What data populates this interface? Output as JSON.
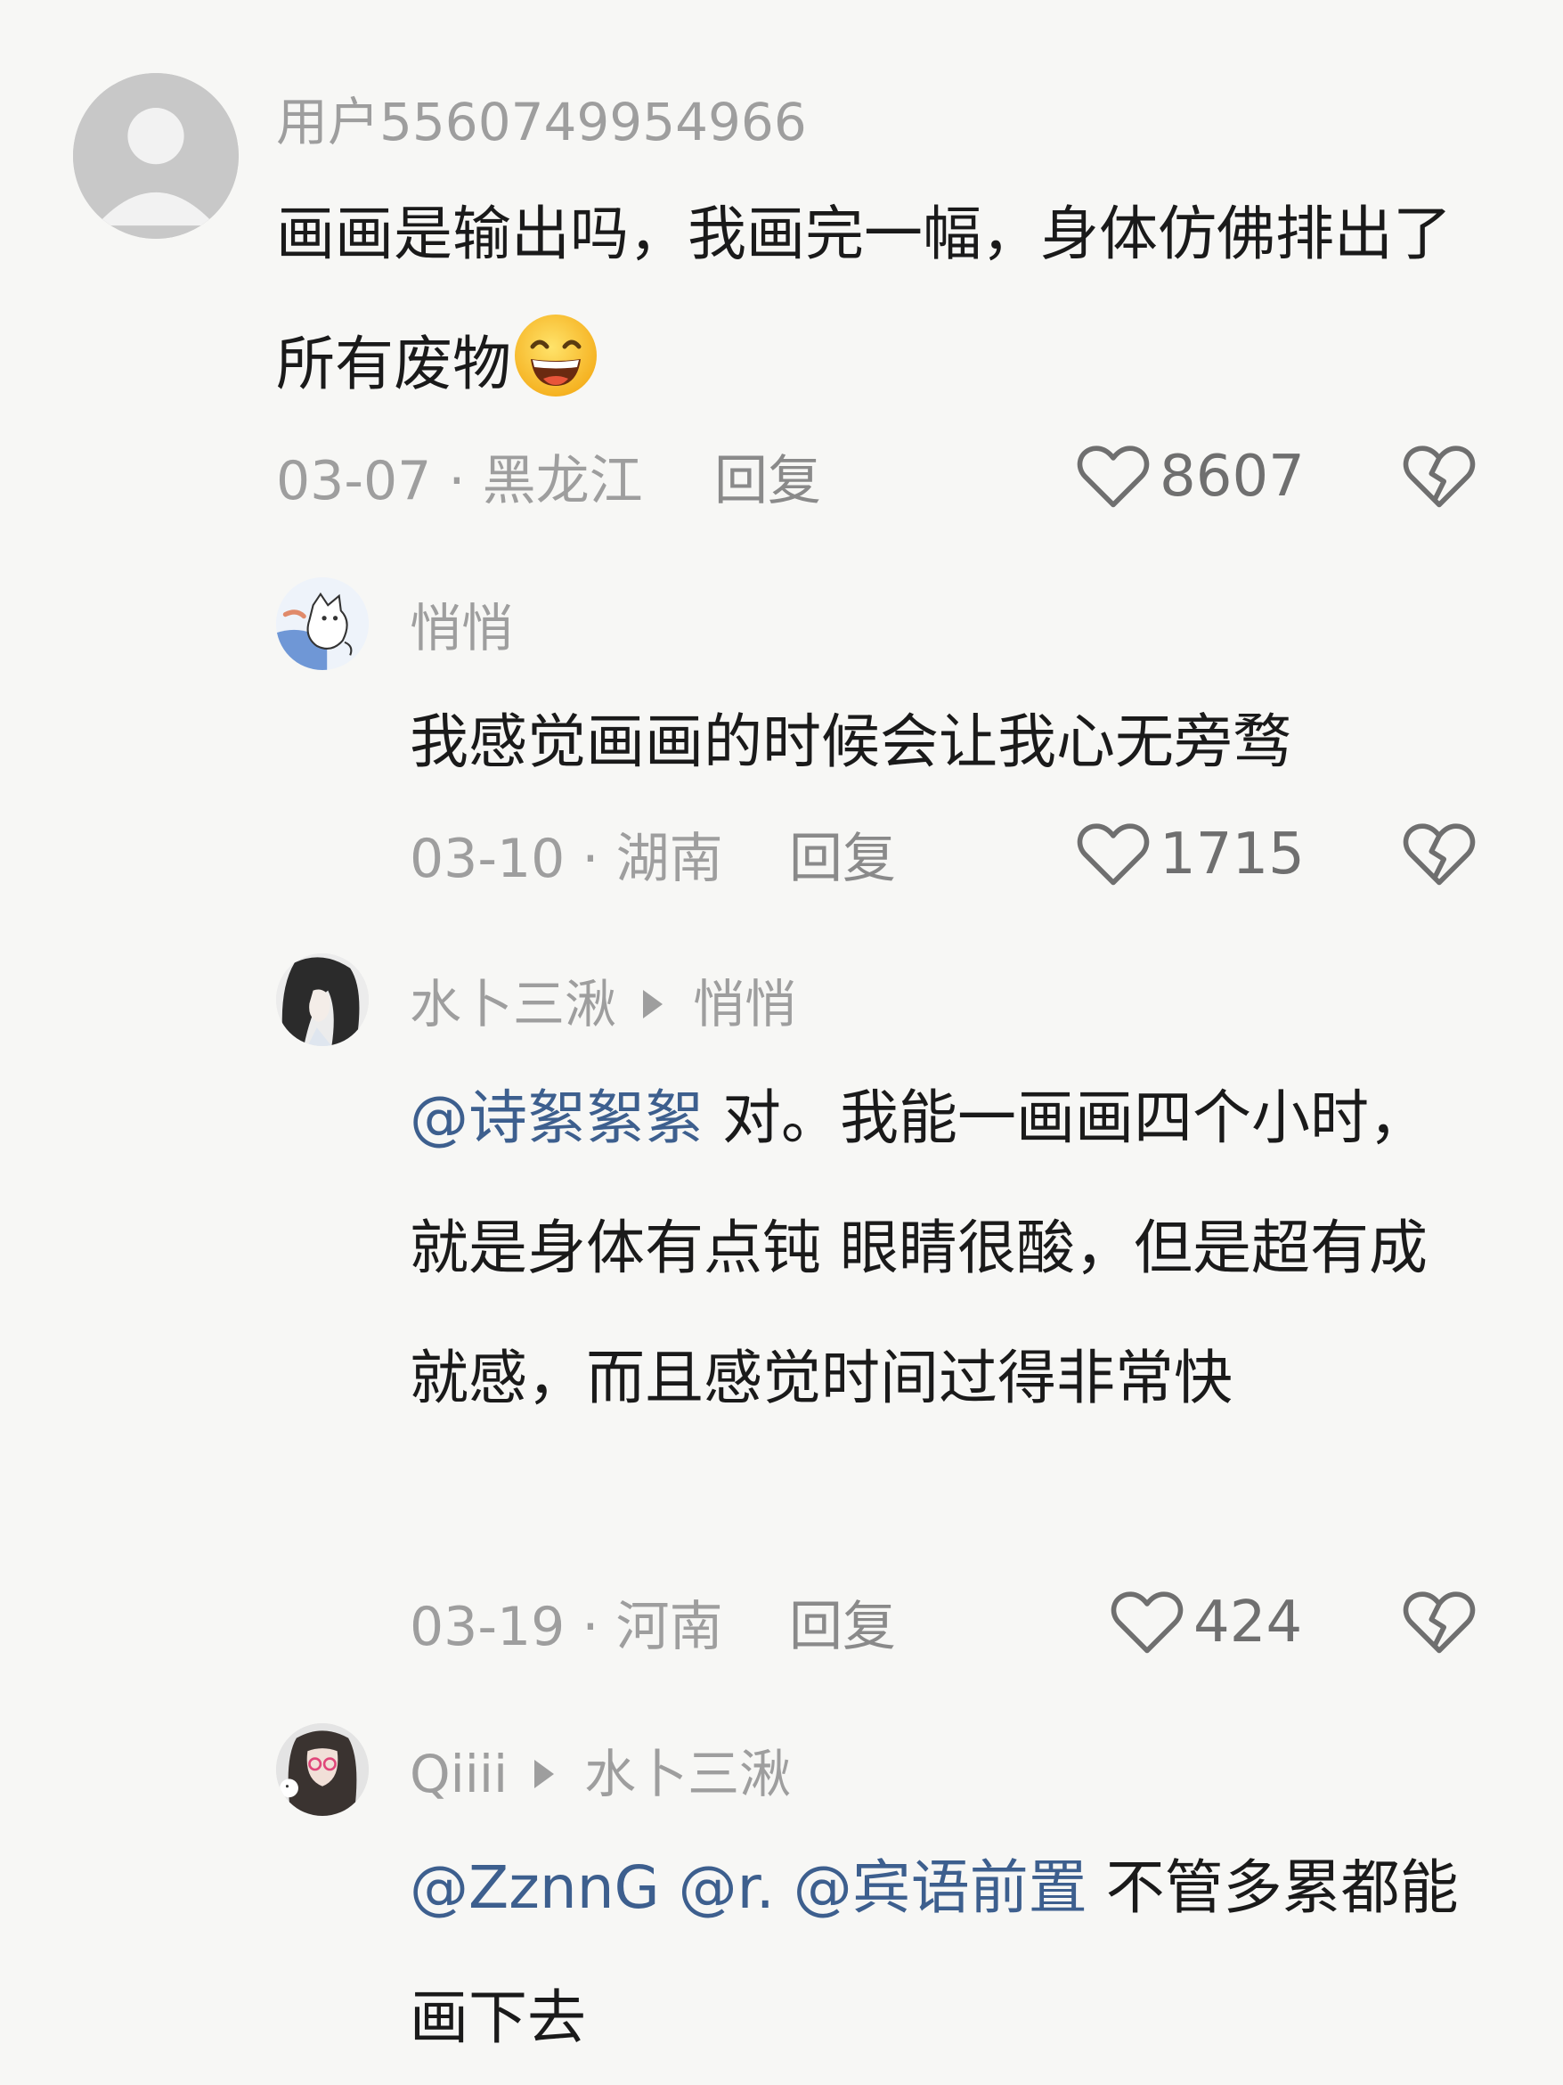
{
  "comments": [
    {
      "username": "用户5560749954966",
      "text": "画画是输出吗，我画完一幅，身体仿佛排出了所有废物",
      "emoji": "grinning-emoji",
      "date": "03-07",
      "location": "黑龙江",
      "reply_label": "回复",
      "likes": "8607"
    },
    {
      "username": "悄悄",
      "text": "我感觉画画的时候会让我心无旁骛",
      "date": "03-10",
      "location": "湖南",
      "reply_label": "回复",
      "likes": "1715"
    },
    {
      "username": "水卜三湫",
      "reply_to": "悄悄",
      "mention": "@诗絮絮絮",
      "text": " 对。我能一画画四个小时，就是身体有点钝 眼睛很酸，但是超有成就感，而且感觉时间过得非常快",
      "date": "03-19",
      "location": "河南",
      "reply_label": "回复",
      "likes": "424"
    },
    {
      "username": "Qiiii",
      "reply_to": "水卜三湫",
      "mentions": [
        "@ZznnG",
        "@r.",
        "@宾语前置"
      ],
      "text": " 不管多累都能画下去"
    }
  ],
  "colors": {
    "background": "#f7f7f5",
    "text": "#1a1a1a",
    "muted": "#9e9e9e",
    "mention": "#3d5f8e"
  }
}
